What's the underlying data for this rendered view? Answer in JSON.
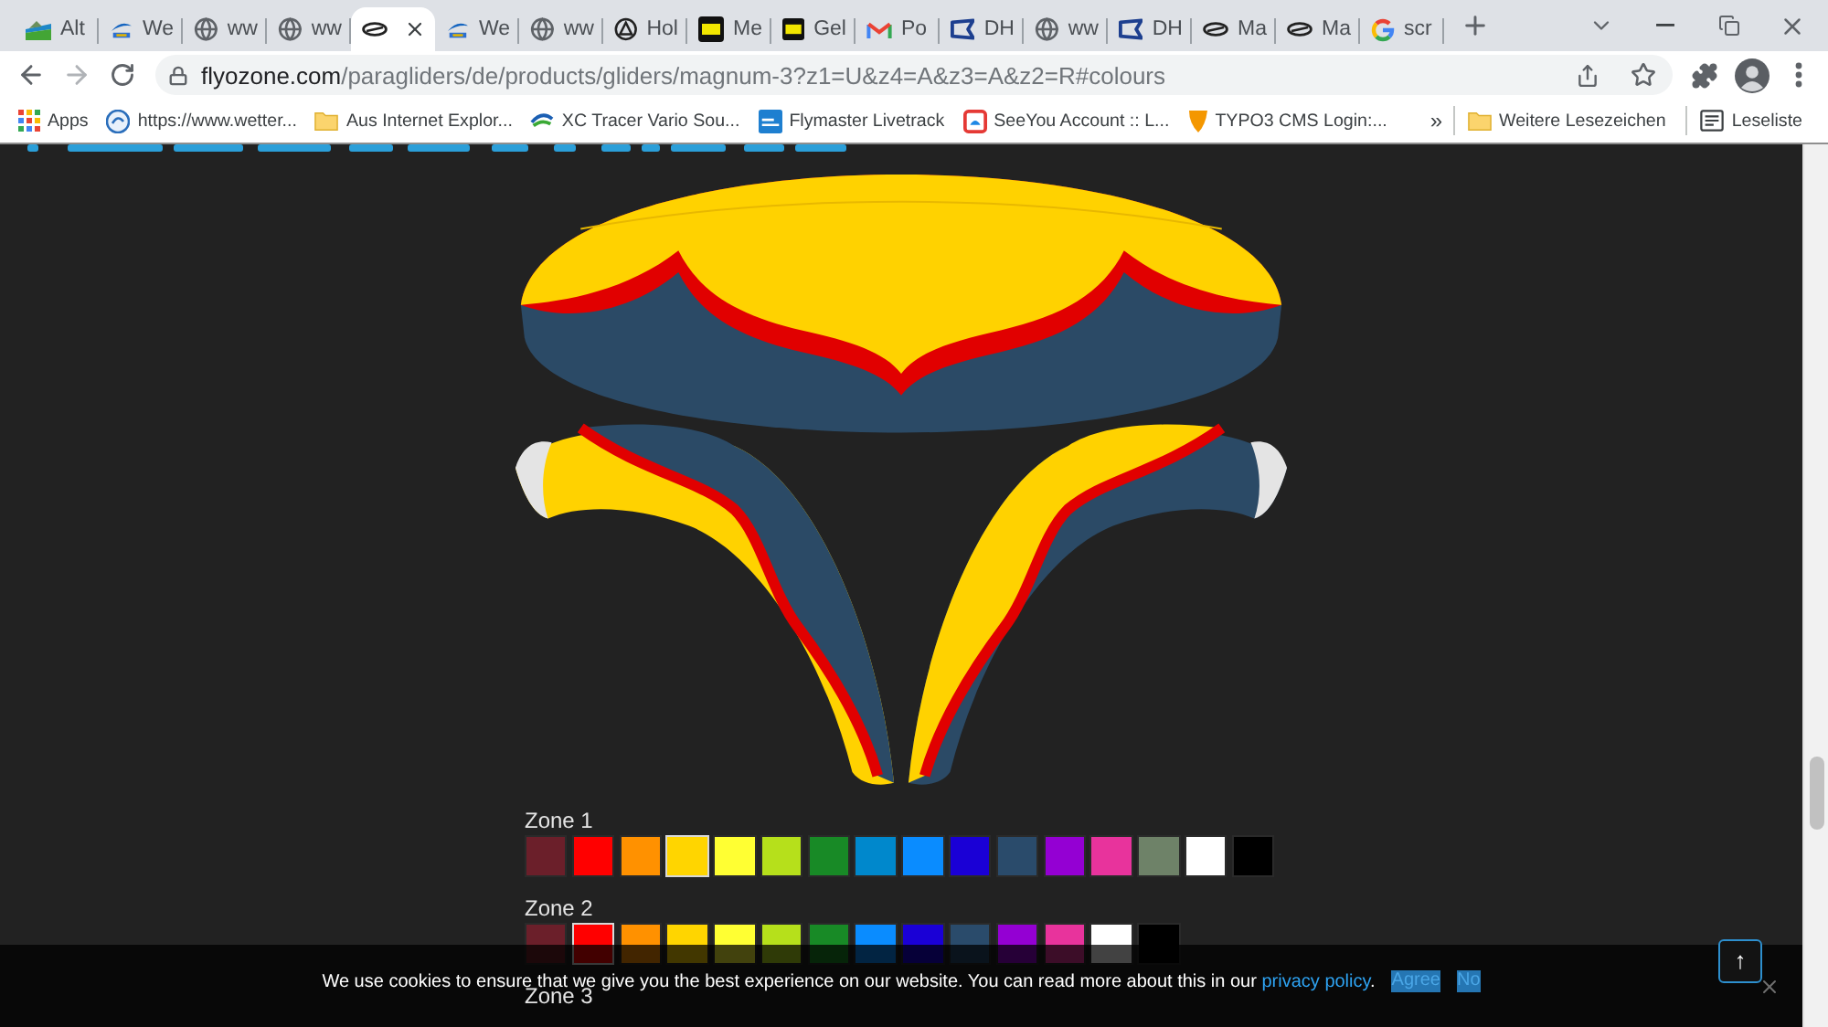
{
  "tabs": [
    {
      "title": "Alt",
      "kind": "alpine",
      "selected": false
    },
    {
      "title": "We",
      "kind": "sair",
      "selected": false
    },
    {
      "title": "ww",
      "kind": "globe",
      "selected": false
    },
    {
      "title": "ww",
      "kind": "globe",
      "selected": false
    },
    {
      "kind": "glider",
      "selected": true
    },
    {
      "title": "We",
      "kind": "sair",
      "selected": false
    },
    {
      "title": "ww",
      "kind": "globe",
      "selected": false
    },
    {
      "title": "Hol",
      "kind": "ring",
      "selected": false
    },
    {
      "title": "Me",
      "kind": "square",
      "selected": false
    },
    {
      "title": "Gel",
      "kind": "square",
      "selected": false
    },
    {
      "title": "Po",
      "kind": "mail",
      "selected": false
    },
    {
      "title": "DH",
      "kind": "flag",
      "selected": false
    },
    {
      "title": "ww",
      "kind": "globe",
      "selected": false
    },
    {
      "title": "DH",
      "kind": "flag",
      "selected": false
    },
    {
      "title": "Ma",
      "kind": "glider",
      "selected": false
    },
    {
      "title": "Ma",
      "kind": "glider",
      "selected": false
    },
    {
      "title": "scr",
      "kind": "google",
      "selected": false
    }
  ],
  "address_bar": {
    "host": "flyozone.com",
    "path": "/paragliders/de/products/gliders/magnum-3?z1=U&z4=A&z3=A&z2=R#colours"
  },
  "bookmarks": [
    {
      "label": "Apps",
      "kind": "apps"
    },
    {
      "label": "https://www.wetter...",
      "kind": "weather"
    },
    {
      "label": "Aus Internet Explor...",
      "kind": "folder"
    },
    {
      "label": "XC Tracer Vario Sou...",
      "kind": "swoosh"
    },
    {
      "label": "Flymaster Livetrack",
      "kind": "tile"
    },
    {
      "label": "SeeYou Account :: L...",
      "kind": "frame"
    },
    {
      "label": "TYPO3 CMS Login:...",
      "kind": "wedge"
    }
  ],
  "bookmarks_overflow": "»",
  "other_bookmarks": [
    {
      "label": "Weitere Lesezeichen",
      "kind": "folder"
    },
    {
      "label": "Leseliste",
      "kind": "reading"
    }
  ],
  "zones": [
    {
      "label": "Zone 1",
      "swatches": [
        {
          "color": "#6b1f2a",
          "selected": false
        },
        {
          "color": "#ff0000",
          "selected": false
        },
        {
          "color": "#ff9100",
          "selected": false
        },
        {
          "color": "#ffd500",
          "selected": true
        },
        {
          "color": "#ffff33",
          "selected": false
        },
        {
          "color": "#b6e01b",
          "selected": false
        },
        {
          "color": "#188a26",
          "selected": false
        },
        {
          "color": "#0088cc",
          "selected": false
        },
        {
          "color": "#0a8cff",
          "selected": false
        },
        {
          "color": "#1a00d6",
          "selected": false
        },
        {
          "color": "#2a4b6b",
          "selected": false
        },
        {
          "color": "#9400d3",
          "selected": false
        },
        {
          "color": "#e8339c",
          "selected": false
        },
        {
          "color": "#6e8268",
          "selected": false
        },
        {
          "color": "#ffffff",
          "selected": false
        },
        {
          "color": "#000000",
          "selected": false
        }
      ]
    },
    {
      "label": "Zone 2",
      "swatches": [
        {
          "color": "#6b1f2a",
          "selected": false
        },
        {
          "color": "#ff0000",
          "selected": true
        },
        {
          "color": "#ff9100",
          "selected": false
        },
        {
          "color": "#ffd500",
          "selected": false
        },
        {
          "color": "#ffff33",
          "selected": false
        },
        {
          "color": "#b6e01b",
          "selected": false
        },
        {
          "color": "#188a26",
          "selected": false
        },
        {
          "color": "#0a8cff",
          "selected": false
        },
        {
          "color": "#1a00d6",
          "selected": false
        },
        {
          "color": "#2a4b6b",
          "selected": false
        },
        {
          "color": "#9400d3",
          "selected": false
        },
        {
          "color": "#e8339c",
          "selected": false
        },
        {
          "color": "#ffffff",
          "selected": false
        },
        {
          "color": "#000000",
          "selected": false
        }
      ]
    },
    {
      "label": "Zone 3"
    }
  ],
  "cookie_banner": {
    "text": "We use cookies to ensure that we give you the best experience on our website. You can read more about this in our",
    "link": "privacy policy",
    "after": ".",
    "buttons": [
      "Agree",
      "No"
    ]
  },
  "back_to_top": "↑"
}
